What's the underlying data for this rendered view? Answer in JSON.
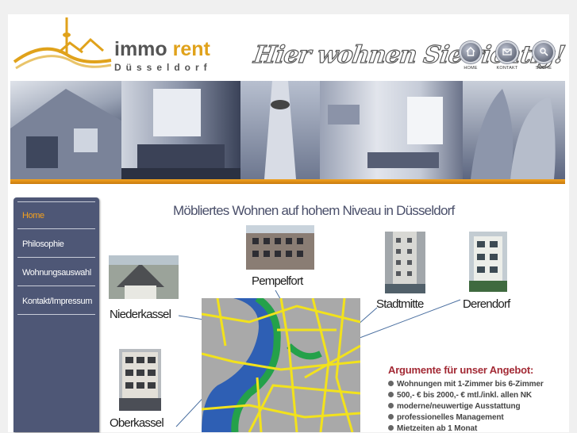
{
  "brand": {
    "name_part1": "immo",
    "name_part2": "rent",
    "city": "Düsseldorf",
    "slogan": "Hier wohnen Sie richtig!"
  },
  "top_nav": [
    {
      "label": "HOME",
      "icon": "home-icon"
    },
    {
      "label": "KONTAKT",
      "icon": "mail-icon"
    },
    {
      "label": "SUCHE",
      "icon": "search-icon"
    }
  ],
  "sidebar": {
    "items": [
      {
        "label": "Home",
        "active": true
      },
      {
        "label": "Philosophie",
        "active": false
      },
      {
        "label": "Wohnungsauswahl",
        "active": false
      },
      {
        "label": "Kontakt/Impressum",
        "active": false
      }
    ]
  },
  "main": {
    "title": "Möbliertes Wohnen auf hohem Niveau in Düsseldorf",
    "districts": {
      "niederkassel": "Niederkassel",
      "pempelfort": "Pempelfort",
      "stadtmitte": "Stadtmitte",
      "derendorf": "Derendorf",
      "oberkassel": "Oberkassel"
    },
    "arguments_title": "Argumente für unser Angebot:",
    "arguments": [
      "Wohnungen mit 1-Zimmer bis 6-Zimmer",
      "500,- € bis 2000,- € mtl./inkl. allen NK",
      "moderne/neuwertige Ausstattung",
      "professionelles Management",
      "Mietzeiten ab 1 Monat"
    ]
  },
  "colors": {
    "accent_orange": "#e0a21b",
    "sidebar_bg": "#4e5776",
    "active_nav": "#f6a11c",
    "args_title": "#a32a35"
  }
}
